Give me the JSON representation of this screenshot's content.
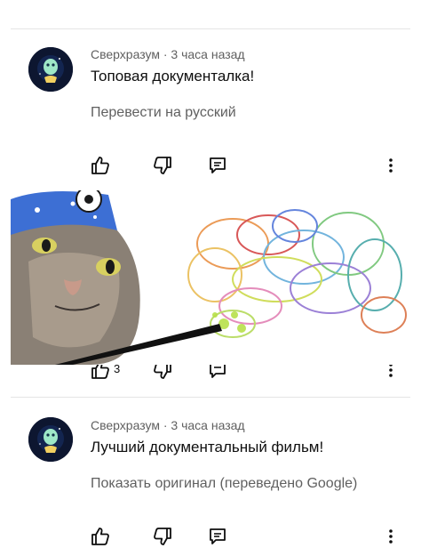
{
  "comments": [
    {
      "author": "Сверхразум",
      "time": "3 часа назад",
      "text": "Топовая документалка!",
      "translate_link": "Перевести на русский",
      "like_count": "3"
    },
    {
      "author": "Сверхразум",
      "time": "3 часа назад",
      "text": "Лучший документальный фильм!",
      "translate_link": "Показать оригинал (переведено Google)"
    }
  ],
  "separator": " · ",
  "icons": [
    "like-icon",
    "dislike-icon",
    "reply-icon",
    "more-vertical-icon"
  ],
  "colors": {
    "secondary_text": "#606060",
    "primary_text": "#0f0f0f",
    "divider": "#e5e5e5"
  }
}
